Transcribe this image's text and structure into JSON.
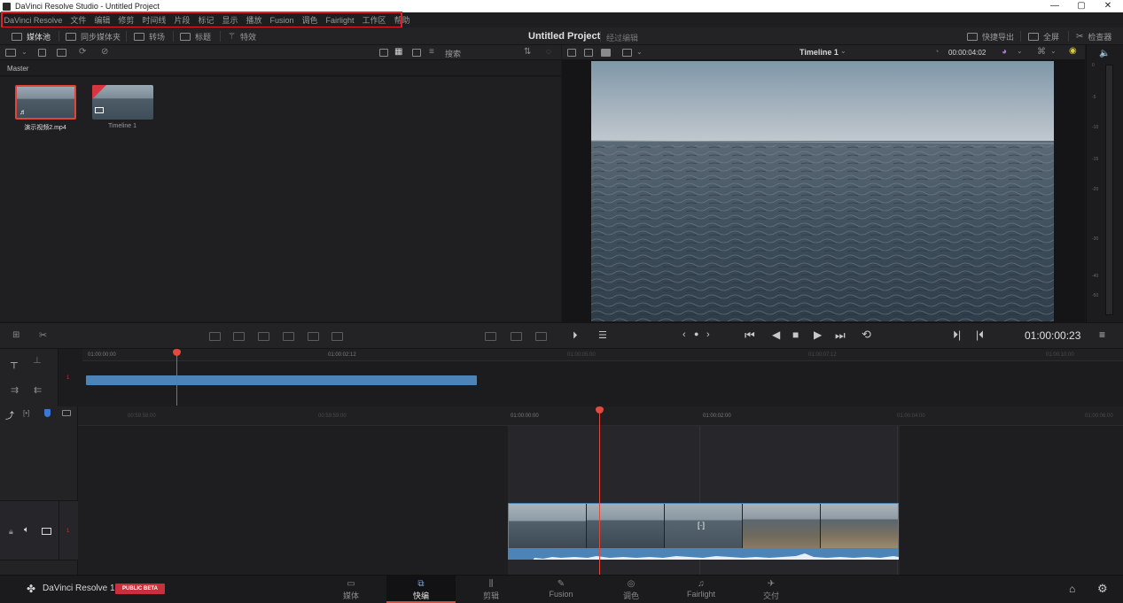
{
  "window": {
    "title": "DaVinci Resolve Studio - Untitled Project",
    "minimize": "—",
    "maximize": "▢",
    "close": "✕"
  },
  "menu": [
    "DaVinci Resolve",
    "文件",
    "编辑",
    "修剪",
    "时间线",
    "片段",
    "标记",
    "显示",
    "播放",
    "Fusion",
    "调色",
    "Fairlight",
    "工作区",
    "帮助"
  ],
  "toolbar": {
    "media_pool": "媒体池",
    "sync_bin": "同步媒体夹",
    "transitions": "转场",
    "titles": "标题",
    "effects": "特效",
    "project_title": "Untitled Project",
    "project_sub": "经过编辑",
    "quick_export": "快捷导出",
    "fullscreen": "全屏",
    "inspector": "检查器"
  },
  "media_pool": {
    "search": "搜索",
    "bin": "Master",
    "clips": [
      {
        "name": "演示视频2.mp4"
      },
      {
        "name": "Timeline 1"
      }
    ]
  },
  "viewer": {
    "timeline_name": "Timeline 1",
    "duration": "00:00:04:02",
    "timecode": "01:00:00:23"
  },
  "meter": {
    "ticks": [
      "0",
      "-5",
      "-10",
      "-15",
      "-20",
      "-30",
      "-40",
      "-50"
    ]
  },
  "upper_timeline": {
    "ticks": [
      "01:00:00:00",
      "01:00:02:12",
      "01:00:05:00",
      "01:00:07:12",
      "01:00:10:00"
    ],
    "track": "1"
  },
  "lower_timeline": {
    "ticks": [
      "00:59:58:00",
      "00:59:59:00",
      "01:00:00:00",
      "01:00:02:00",
      "01:00:04:00",
      "01:00:06:00"
    ],
    "track": "1"
  },
  "footer": {
    "logo": "DaVinci Resolve 18",
    "badge": "PUBLIC BETA",
    "pages": [
      {
        "label": "媒体",
        "icon": "▭"
      },
      {
        "label": "快编",
        "icon": "⧉"
      },
      {
        "label": "剪辑",
        "icon": "⫼"
      },
      {
        "label": "Fusion",
        "icon": "✎"
      },
      {
        "label": "调色",
        "icon": "◎"
      },
      {
        "label": "Fairlight",
        "icon": "♫"
      },
      {
        "label": "交付",
        "icon": "✈"
      }
    ],
    "active_page": "快编"
  },
  "colors": {
    "accent": "#e24a3d",
    "clip_blue": "#4d84b8",
    "highlight": "#e3202a"
  }
}
